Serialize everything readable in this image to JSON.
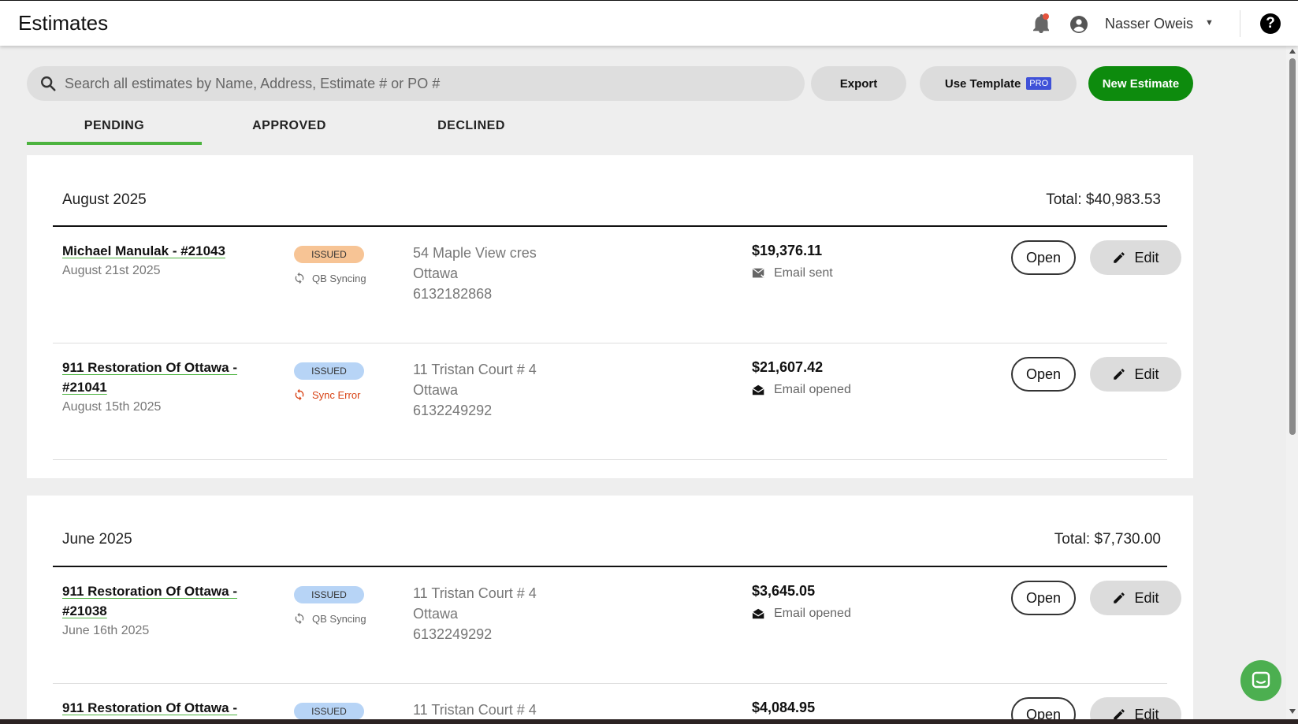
{
  "header": {
    "title": "Estimates",
    "user_name": "Nasser Oweis"
  },
  "toolbar": {
    "search_placeholder": "Search all estimates by Name, Address, Estimate # or PO #",
    "export_label": "Export",
    "use_template_label": "Use Template",
    "pro_badge": "PRO",
    "new_estimate_label": "New Estimate"
  },
  "tabs": [
    {
      "label": "PENDING",
      "active": true
    },
    {
      "label": "APPROVED",
      "active": false
    },
    {
      "label": "DECLINED",
      "active": false
    }
  ],
  "groups": [
    {
      "month": "August 2025",
      "total": "Total: $40,983.53",
      "rows": [
        {
          "name": "Michael Manulak - #21043",
          "date": "August 21st 2025",
          "status": "ISSUED",
          "status_color": "#f7c495",
          "sync": "QB Syncing",
          "address": "54 Maple View cres",
          "city": "Ottawa",
          "phone": "6132182868",
          "amount": "$19,376.11",
          "email_status": "Email sent",
          "open_label": "Open",
          "edit_label": "Edit"
        },
        {
          "name": "911 Restoration Of Ottawa - #21041",
          "date": "August 15th 2025",
          "status": "ISSUED",
          "status_color": "#b7d4f6",
          "sync": "Sync Error",
          "address": "11 Tristan Court # 4",
          "city": "Ottawa",
          "phone": "6132249292",
          "amount": "$21,607.42",
          "email_status": "Email opened",
          "open_label": "Open",
          "edit_label": "Edit"
        }
      ]
    },
    {
      "month": "June 2025",
      "total": "Total: $7,730.00",
      "rows": [
        {
          "name": "911 Restoration Of Ottawa - #21038",
          "date": "June 16th 2025",
          "status": "ISSUED",
          "status_color": "#b7d4f6",
          "sync": "QB Syncing",
          "address": "11 Tristan Court # 4",
          "city": "Ottawa",
          "phone": "6132249292",
          "amount": "$3,645.05",
          "email_status": "Email opened",
          "open_label": "Open",
          "edit_label": "Edit"
        },
        {
          "name": "911 Restoration Of Ottawa -",
          "status": "ISSUED",
          "status_color": "#b7d4f6",
          "address": "11 Tristan Court # 4",
          "amount": "$4,084.95",
          "open_label": "Open",
          "edit_label": "Edit"
        }
      ]
    }
  ],
  "icons": {
    "notification": "bell-icon",
    "account": "user-circle-icon",
    "help": "help-icon",
    "search": "search-icon",
    "sync": "sync-icon",
    "email_sent": "mail-sent-icon",
    "email_opened": "mail-open-icon",
    "edit": "pencil-icon",
    "chat": "chat-icon"
  },
  "colors": {
    "accent_green": "#0d8b0d",
    "tab_underline": "#4cb33f",
    "sync_error": "#d84315",
    "pro_badge": "#3f51d8"
  }
}
